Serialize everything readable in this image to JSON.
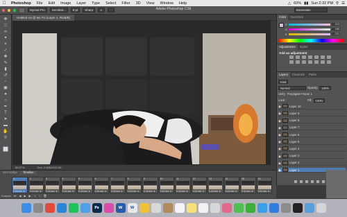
{
  "menubar": {
    "apple_icon": "apple-icon",
    "items": [
      "Photoshop",
      "File",
      "Edit",
      "Image",
      "Layer",
      "Type",
      "Select",
      "Filter",
      "3D",
      "View",
      "Window",
      "Help"
    ],
    "battery": "60%",
    "clock": "Sun 2:32 PM"
  },
  "optionsbar": {
    "app_title": "Adobe Photoshop CS6",
    "font_family": "Myriad Pro",
    "font_style": "Semibol...",
    "font_size": "8 pt",
    "anti_alias": "Sharp",
    "workspace": "Essentials"
  },
  "document": {
    "tab_label": "Untitled-14 @ 66.7% (Layer 1, RGB/8)",
    "zoom": "66.67%",
    "doc_size": "Doc: 2.64M/253.1M"
  },
  "color_panel": {
    "tabs": [
      "Color",
      "Swatches"
    ],
    "r_label": "R",
    "g_label": "G",
    "b_label": "B",
    "r": "215",
    "g": "186",
    "b": "221"
  },
  "adjustments_panel": {
    "tabs": [
      "Adjustments",
      "Styles"
    ],
    "title": "Add an adjustment"
  },
  "layers_panel": {
    "tabs": [
      "Layers",
      "Channels",
      "Paths"
    ],
    "kind_filter": "Kind",
    "blend_mode": "Normal",
    "opacity_label": "Opacity:",
    "opacity": "100%",
    "unify_label": "Unify:",
    "propagate": "Propagate Frame 1",
    "lock_label": "Lock:",
    "fill_label": "Fill:",
    "fill": "100%",
    "layers": [
      "Layer 10",
      "Layer 9",
      "Layer 8",
      "Layer 7",
      "Layer 6",
      "Layer 5",
      "Layer 4",
      "Layer 3",
      "Layer 2",
      "Layer 1"
    ],
    "selected_layer": "Layer 1"
  },
  "timeline": {
    "tabs": [
      "Mini Bridge",
      "Timeline"
    ],
    "loop": "Forever",
    "frames": [
      {
        "n": "1",
        "delay": "0.04 sec."
      },
      {
        "n": "2",
        "delay": "0.04 sec."
      },
      {
        "n": "3",
        "delay": "0.04 sec."
      },
      {
        "n": "4",
        "delay": "0.04 sec."
      },
      {
        "n": "5",
        "delay": "0.04 sec."
      },
      {
        "n": "6",
        "delay": "0.04 sec."
      },
      {
        "n": "7",
        "delay": "0.04 sec."
      },
      {
        "n": "8",
        "delay": "0.04 sec."
      },
      {
        "n": "9",
        "delay": "0.04 sec."
      },
      {
        "n": "10",
        "delay": "0.04 sec."
      },
      {
        "n": "11",
        "delay": "0.04 sec."
      },
      {
        "n": "12",
        "delay": "0.04 sec."
      },
      {
        "n": "13",
        "delay": "0.04 sec."
      },
      {
        "n": "14",
        "delay": "0.04 sec."
      },
      {
        "n": "15",
        "delay": "0.04 sec."
      },
      {
        "n": "16",
        "delay": "0.04 sec."
      }
    ]
  },
  "dock": {
    "icons": [
      {
        "name": "finder-icon",
        "glyph": "",
        "color": "#3b8ee6"
      },
      {
        "name": "launchpad-icon",
        "glyph": "",
        "color": "#8a8a8a"
      },
      {
        "name": "chrome-icon",
        "glyph": "",
        "color": "#e14b3a"
      },
      {
        "name": "safari-icon",
        "glyph": "",
        "color": "#2c86d6"
      },
      {
        "name": "spotify-icon",
        "glyph": "",
        "color": "#1ec45c"
      },
      {
        "name": "mail-icon",
        "glyph": "",
        "color": "#4fa0e8"
      },
      {
        "name": "photoshop-icon",
        "glyph": "Ps",
        "color": "#0b2b4a"
      },
      {
        "name": "itunes-icon",
        "glyph": "",
        "color": "#d94da8"
      },
      {
        "name": "word-icon",
        "glyph": "W",
        "color": "#2b5aa8"
      },
      {
        "name": "word-doc-icon",
        "glyph": "W",
        "color": "#e8e8e8"
      },
      {
        "name": "photos-icon",
        "glyph": "",
        "color": "#f0c23a"
      },
      {
        "name": "files-icon",
        "glyph": "",
        "color": "#d9d9d9"
      },
      {
        "name": "bag-icon",
        "glyph": "",
        "color": "#b08a5a"
      },
      {
        "name": "calendar-icon",
        "glyph": "",
        "color": "#f4f4f4"
      },
      {
        "name": "notes-icon",
        "glyph": "",
        "color": "#f7e27a"
      },
      {
        "name": "reminders-icon",
        "glyph": "",
        "color": "#f2f2f2"
      },
      {
        "name": "preview-icon",
        "glyph": "",
        "color": "#d8d8d8"
      },
      {
        "name": "color-wheel-icon",
        "glyph": "",
        "color": "#e06b8a"
      },
      {
        "name": "messages-icon",
        "glyph": "",
        "color": "#4fc04f"
      },
      {
        "name": "facetime-icon",
        "glyph": "",
        "color": "#3ab03a"
      },
      {
        "name": "itunes-store-icon",
        "glyph": "",
        "color": "#3aa0e8"
      },
      {
        "name": "app-store-icon",
        "glyph": "",
        "color": "#2f7fe0"
      },
      {
        "name": "system-preferences-icon",
        "glyph": "",
        "color": "#8c8c8c"
      },
      {
        "name": "dark-app-icon",
        "glyph": "",
        "color": "#222222"
      },
      {
        "name": "finder-window-icon",
        "glyph": "",
        "color": "#5aa0d8"
      },
      {
        "name": "trash-icon",
        "glyph": "",
        "color": "#d5d5d5"
      }
    ]
  }
}
